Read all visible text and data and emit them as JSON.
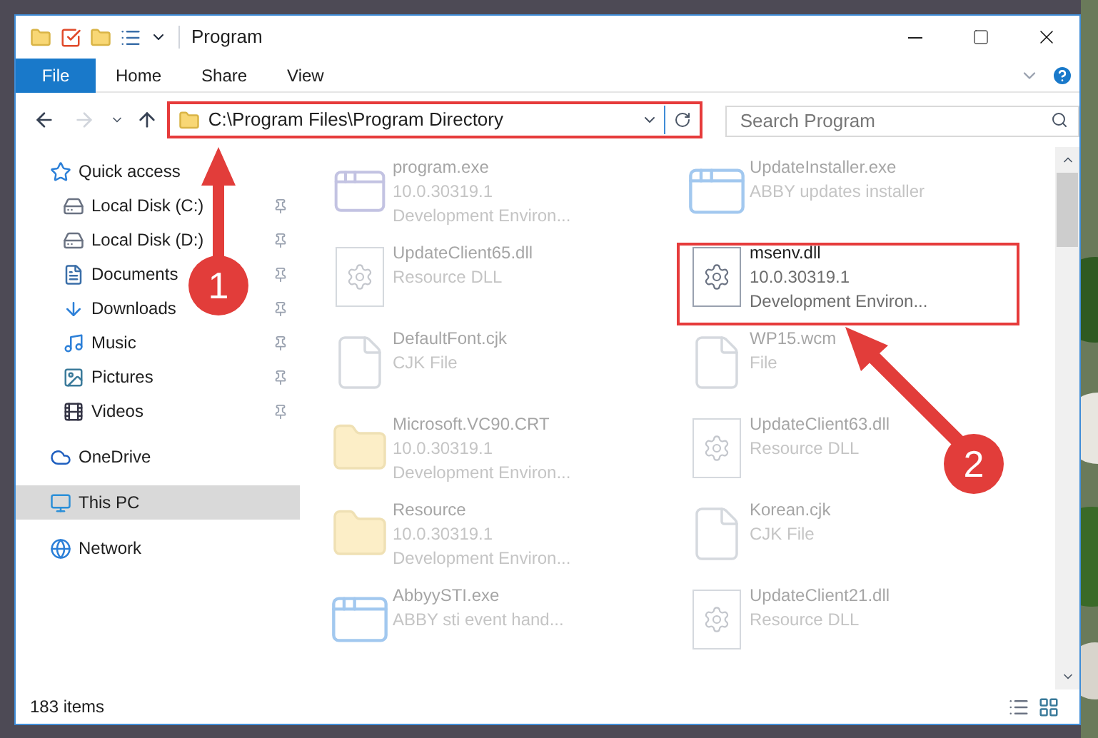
{
  "window": {
    "title": "Program"
  },
  "ribbon_tabs": [
    {
      "label": "File",
      "kind": "file"
    },
    {
      "label": "Home",
      "kind": "tab"
    },
    {
      "label": "Share",
      "kind": "tab"
    },
    {
      "label": "View",
      "kind": "tab"
    }
  ],
  "address": {
    "value": "C:\\Program Files\\Program Directory"
  },
  "search": {
    "placeholder": "Search Program"
  },
  "sidebar": {
    "items": [
      {
        "label": "Quick access",
        "kind": "star",
        "selected": false,
        "children": [
          {
            "label": "Local Disk (C:)",
            "kind": "drive",
            "pinned": true,
            "selected": false
          },
          {
            "label": "Local Disk (D:)",
            "kind": "drive",
            "pinned": true,
            "selected": false
          },
          {
            "label": "Documents",
            "kind": "documents",
            "pinned": true,
            "selected": false
          },
          {
            "label": "Downloads",
            "kind": "downloads",
            "pinned": true,
            "selected": false
          },
          {
            "label": "Music",
            "kind": "music",
            "pinned": true,
            "selected": false
          },
          {
            "label": "Pictures",
            "kind": "pictures",
            "pinned": true,
            "selected": false
          },
          {
            "label": "Videos",
            "kind": "videos",
            "pinned": true,
            "selected": false
          }
        ]
      },
      {
        "label": "OneDrive",
        "kind": "cloud",
        "selected": false
      },
      {
        "label": "This PC",
        "kind": "pc",
        "selected": true
      },
      {
        "label": "Network",
        "kind": "network",
        "selected": false
      }
    ]
  },
  "files": [
    {
      "name": "program.exe",
      "details": [
        "10.0.30319.1",
        "Development Environ..."
      ],
      "kind": "exe",
      "blurred": true
    },
    {
      "name": "UpdateInstaller.exe",
      "details": [
        "ABBY updates installer"
      ],
      "kind": "app",
      "blurred": true
    },
    {
      "name": "UpdateClient65.dll",
      "details": [
        "Resource DLL"
      ],
      "kind": "dll",
      "blurred": true
    },
    {
      "name": "msenv.dll",
      "details": [
        "10.0.30319.1",
        "Development Environ..."
      ],
      "kind": "dll",
      "blurred": false
    },
    {
      "name": "DefaultFont.cjk",
      "details": [
        "CJK File"
      ],
      "kind": "blank",
      "blurred": true
    },
    {
      "name": "WP15.wcm",
      "details": [
        "File"
      ],
      "kind": "blank",
      "blurred": true
    },
    {
      "name": "Microsoft.VC90.CRT",
      "details": [
        "10.0.30319.1",
        "Development Environ..."
      ],
      "kind": "folder",
      "blurred": true
    },
    {
      "name": "UpdateClient63.dll",
      "details": [
        "Resource DLL"
      ],
      "kind": "dll",
      "blurred": true
    },
    {
      "name": "Resource",
      "details": [
        "10.0.30319.1",
        "Development Environ..."
      ],
      "kind": "folder",
      "blurred": true
    },
    {
      "name": "Korean.cjk",
      "details": [
        "CJK File"
      ],
      "kind": "blank",
      "blurred": true
    },
    {
      "name": "AbbyySTI.exe",
      "details": [
        "ABBY sti event hand..."
      ],
      "kind": "app",
      "blurred": true
    },
    {
      "name": "UpdateClient21.dll",
      "details": [
        "Resource DLL"
      ],
      "kind": "dll",
      "blurred": true
    }
  ],
  "status_bar": {
    "count": "183 items"
  },
  "annotations": [
    {
      "label": "1"
    },
    {
      "label": "2"
    }
  ]
}
